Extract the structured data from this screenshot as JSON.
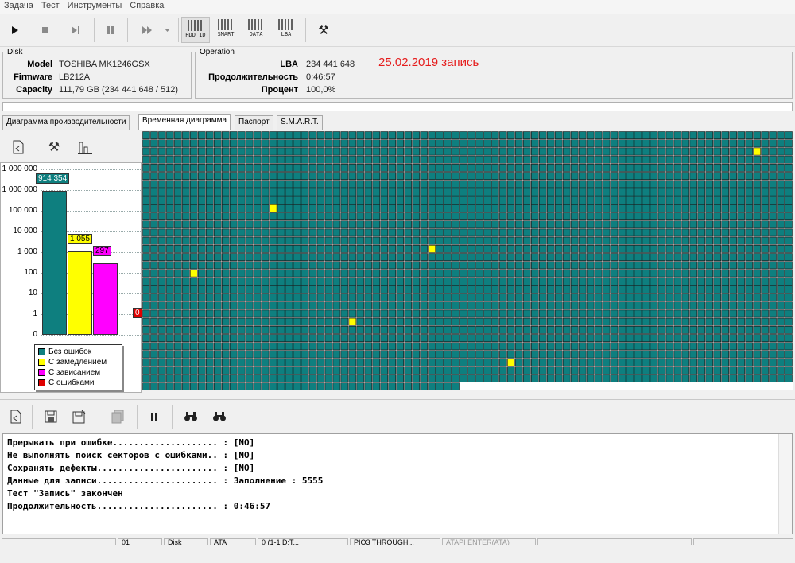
{
  "menu": [
    "Задача",
    "Тест",
    "Инструменты",
    "Справка"
  ],
  "toolbar": {
    "text_buttons": [
      {
        "label": "HDD ID"
      },
      {
        "label": "SMART"
      },
      {
        "label": "DATA"
      },
      {
        "label": "LBA"
      }
    ]
  },
  "disk": {
    "legend": "Disk",
    "model_label": "Model",
    "model": "TOSHIBA MK1246GSX",
    "firmware_label": "Firmware",
    "firmware": "LB212A",
    "capacity_label": "Capacity",
    "capacity": "111,79 GB (234 441 648 / 512)"
  },
  "operation": {
    "legend": "Operation",
    "lba_label": "LBA",
    "lba": "234 441 648",
    "duration_label": "Продолжительность",
    "duration": "0:46:57",
    "percent_label": "Процент",
    "percent": "100,0%",
    "note": "25.02.2019 запись"
  },
  "progress": {
    "fraction": 0.0
  },
  "tabs": [
    {
      "label": "Диаграмма производительности",
      "active": false
    },
    {
      "label": "Временная диаграмма",
      "active": true
    },
    {
      "label": "Паспорт",
      "active": false
    },
    {
      "label": "S.M.A.R.T.",
      "active": false
    }
  ],
  "chart_data": {
    "type": "bar",
    "yscale": "log",
    "ytick_labels": [
      "1 000 000",
      "1 000 000",
      "100 000",
      "10 000",
      "1 000",
      "100",
      "10",
      "1",
      "0"
    ],
    "categories": [
      "Без ошибок",
      "С замедлением",
      "С зависанием",
      "С ошибками"
    ],
    "values": [
      914354,
      1055,
      297,
      0
    ],
    "labels": [
      "914 354",
      "1 055",
      "297",
      "0"
    ],
    "colors": [
      "#0e7f7f",
      "#ffff00",
      "#ff00ff",
      "#e00000"
    ],
    "legend": [
      "Без ошибок",
      "С замедлением",
      "С зависанием",
      "С ошибками"
    ],
    "grid": true
  },
  "sector_map": {
    "columns": 82,
    "rows": 32,
    "filled_last_row": 40,
    "block_color": "#0e7f7f",
    "highlight_color": "#ffff00",
    "highlights": [
      [
        2,
        77
      ],
      [
        9,
        16
      ],
      [
        14,
        36
      ],
      [
        17,
        6
      ],
      [
        23,
        26
      ],
      [
        28,
        46
      ]
    ]
  },
  "log": [
    "Прерывать при ошибке.................... : [NO]",
    "Не выполнять поиск секторов с ошибками.. : [NO]",
    "Сохранять дефекты....................... : [NO]",
    "Данные для записи....................... : Заполнение : 5555",
    "Тест \"Запись\" закончен",
    "Продолжительность....................... : 0:46:57"
  ],
  "status": [
    "",
    "01",
    "Disk",
    "ATA",
    "0 (1-1 D:T...",
    "PIO3 THROUGH...",
    "ATAPI ENTER(ATA)",
    "",
    ""
  ]
}
